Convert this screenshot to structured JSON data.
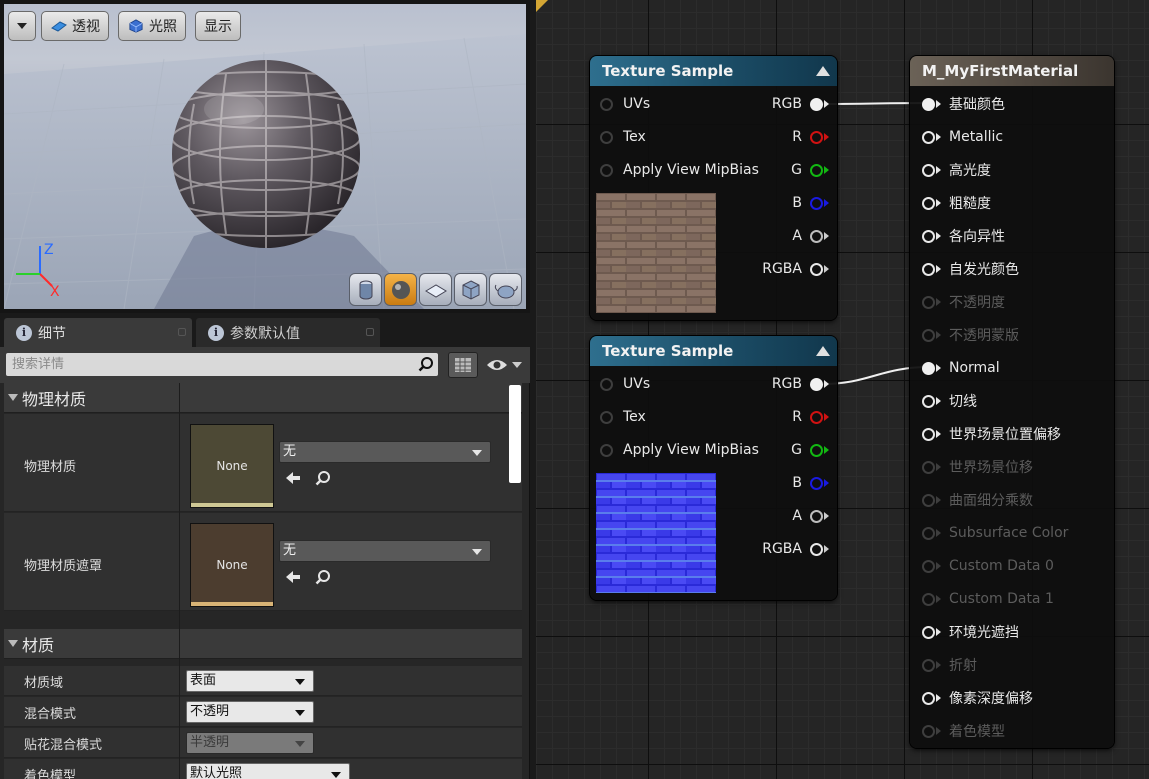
{
  "viewport": {
    "buttons": {
      "menu_label": "",
      "perspective_label": "透视",
      "lighting_label": "光照",
      "show_label": "显示"
    },
    "axes": {
      "z": "Z",
      "x": "X"
    },
    "preview_tools": [
      "cylinder-icon",
      "sphere-icon",
      "plane-icon",
      "cube-icon",
      "teapot-icon"
    ]
  },
  "details": {
    "tabs": [
      {
        "label": "细节",
        "icon": "info-icon",
        "active": true
      },
      {
        "label": "参数默认值",
        "icon": "info-icon",
        "active": false
      }
    ],
    "search": {
      "placeholder": "搜索详情"
    },
    "categories": [
      {
        "title": "物理材质",
        "properties": [
          {
            "label": "物理材质",
            "thumb": "None",
            "value": "无"
          },
          {
            "label": "物理材质遮罩",
            "thumb": "None",
            "value": "无"
          }
        ]
      },
      {
        "title": "材质",
        "properties": [
          {
            "label": "材质域",
            "value": "表面"
          },
          {
            "label": "混合模式",
            "value": "不透明"
          },
          {
            "label": "贴花混合模式",
            "value": "半透明"
          },
          {
            "label": "着色模型",
            "value": "默认光照"
          }
        ]
      }
    ]
  },
  "graph": {
    "texture_nodes": [
      {
        "title": "Texture Sample",
        "inputs": [
          "UVs",
          "Tex",
          "Apply View MipBias"
        ],
        "outputs": [
          "RGB",
          "R",
          "G",
          "B",
          "A",
          "RGBA"
        ],
        "preview": "brick-diffuse"
      },
      {
        "title": "Texture Sample",
        "inputs": [
          "UVs",
          "Tex",
          "Apply View MipBias"
        ],
        "outputs": [
          "RGB",
          "R",
          "G",
          "B",
          "A",
          "RGBA"
        ],
        "preview": "brick-normal"
      }
    ],
    "material_node": {
      "title": "M_MyFirstMaterial",
      "inputs": [
        {
          "label": "基础颜色",
          "enabled": true,
          "connected": true
        },
        {
          "label": "Metallic",
          "enabled": true
        },
        {
          "label": "高光度",
          "enabled": true
        },
        {
          "label": "粗糙度",
          "enabled": true
        },
        {
          "label": "各向异性",
          "enabled": true
        },
        {
          "label": "自发光颜色",
          "enabled": true
        },
        {
          "label": "不透明度",
          "enabled": false
        },
        {
          "label": "不透明蒙版",
          "enabled": false
        },
        {
          "label": "Normal",
          "enabled": true,
          "connected": true
        },
        {
          "label": "切线",
          "enabled": true
        },
        {
          "label": "世界场景位置偏移",
          "enabled": true
        },
        {
          "label": "世界场景位移",
          "enabled": false
        },
        {
          "label": "曲面细分乘数",
          "enabled": false
        },
        {
          "label": "Subsurface Color",
          "enabled": false
        },
        {
          "label": "Custom Data 0",
          "enabled": false
        },
        {
          "label": "Custom Data 1",
          "enabled": false
        },
        {
          "label": "环境光遮挡",
          "enabled": true
        },
        {
          "label": "折射",
          "enabled": false
        },
        {
          "label": "像素深度偏移",
          "enabled": true
        },
        {
          "label": "着色模型",
          "enabled": false
        }
      ]
    }
  }
}
